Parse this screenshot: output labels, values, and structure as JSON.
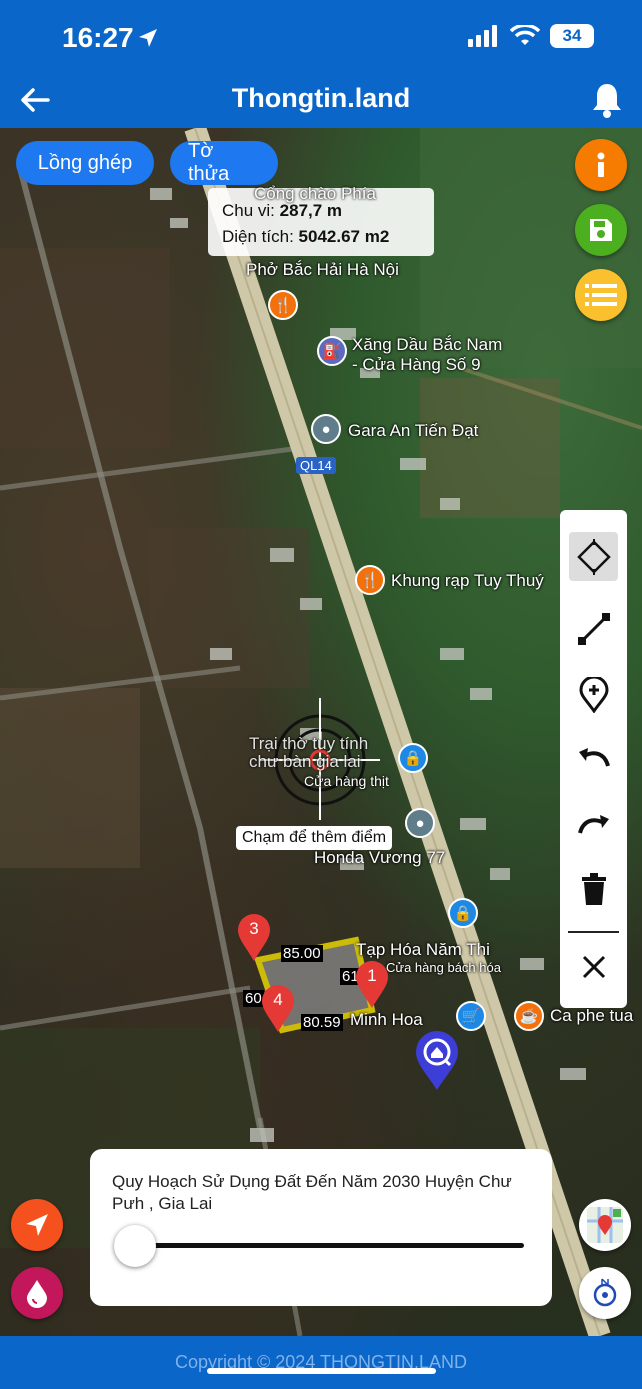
{
  "status": {
    "time": "16:27",
    "battery": "34"
  },
  "header": {
    "title": "Thongtin.land"
  },
  "chips": [
    {
      "label": "Lồng ghép"
    },
    {
      "label": "Tờ thửa"
    }
  ],
  "measure": {
    "perimeter_label": "Chu vi:",
    "perimeter_value": "287,7 m",
    "area_label": "Diện tích:",
    "area_value": "5042.67 m2"
  },
  "pois": [
    {
      "label": "Cổng chào Phía"
    },
    {
      "label": "Phở Bắc Hải Hà Nội"
    },
    {
      "label": "Xăng Dầu Bắc Nam\n- Cửa Hàng Số 9"
    },
    {
      "label": "Gara An Tiến Đạt"
    },
    {
      "label": "QL14"
    },
    {
      "label": "Khung rạp Tuy Thuý"
    },
    {
      "label": "Trại thờ tuy tính\nchư bàn gia lai"
    },
    {
      "label": "Cửa hàng thịt"
    },
    {
      "label": "Honda Vương 77"
    },
    {
      "label": "Tạp Hóa Năm Thi"
    },
    {
      "label": "Cửa hàng bách hóa"
    },
    {
      "label": "Minh Hoa"
    },
    {
      "label": "Ca phe tua"
    }
  ],
  "hint": "Chạm để thêm điểm",
  "polygon": {
    "edges": [
      "85.00",
      "61",
      "60",
      "80.59"
    ],
    "markers": [
      "3",
      "1",
      "4"
    ]
  },
  "layer": {
    "title": "Quy Hoạch Sử Dụng Đất Đến Năm 2030 Huyện Chư Pưh , Gia Lai",
    "opacity": 0
  },
  "footer": {
    "copyright": "Copyright © 2024 THONGTIN.LAND"
  },
  "colors": {
    "primary": "#0a66c9",
    "chip": "#1e78f0",
    "info": "#f57c00",
    "save": "#4caf1f",
    "list": "#fbc02d",
    "polygon": "#ffeb00",
    "marker": "#e53935",
    "locate": "#f4511e",
    "water": "#c2185b"
  },
  "icons": {
    "back": "arrow-left-icon",
    "bell": "bell-icon",
    "info": "info-icon",
    "save": "save-icon",
    "list": "list-icon",
    "select": "diamond-select-icon",
    "line": "line-tool-icon",
    "add_point": "add-location-icon",
    "undo": "undo-icon",
    "redo": "redo-icon",
    "delete": "trash-icon",
    "close": "close-icon",
    "locate": "navigation-arrow-icon",
    "water": "water-drop-icon",
    "map_thumb": "map-layer-icon",
    "compass": "compass-icon"
  }
}
